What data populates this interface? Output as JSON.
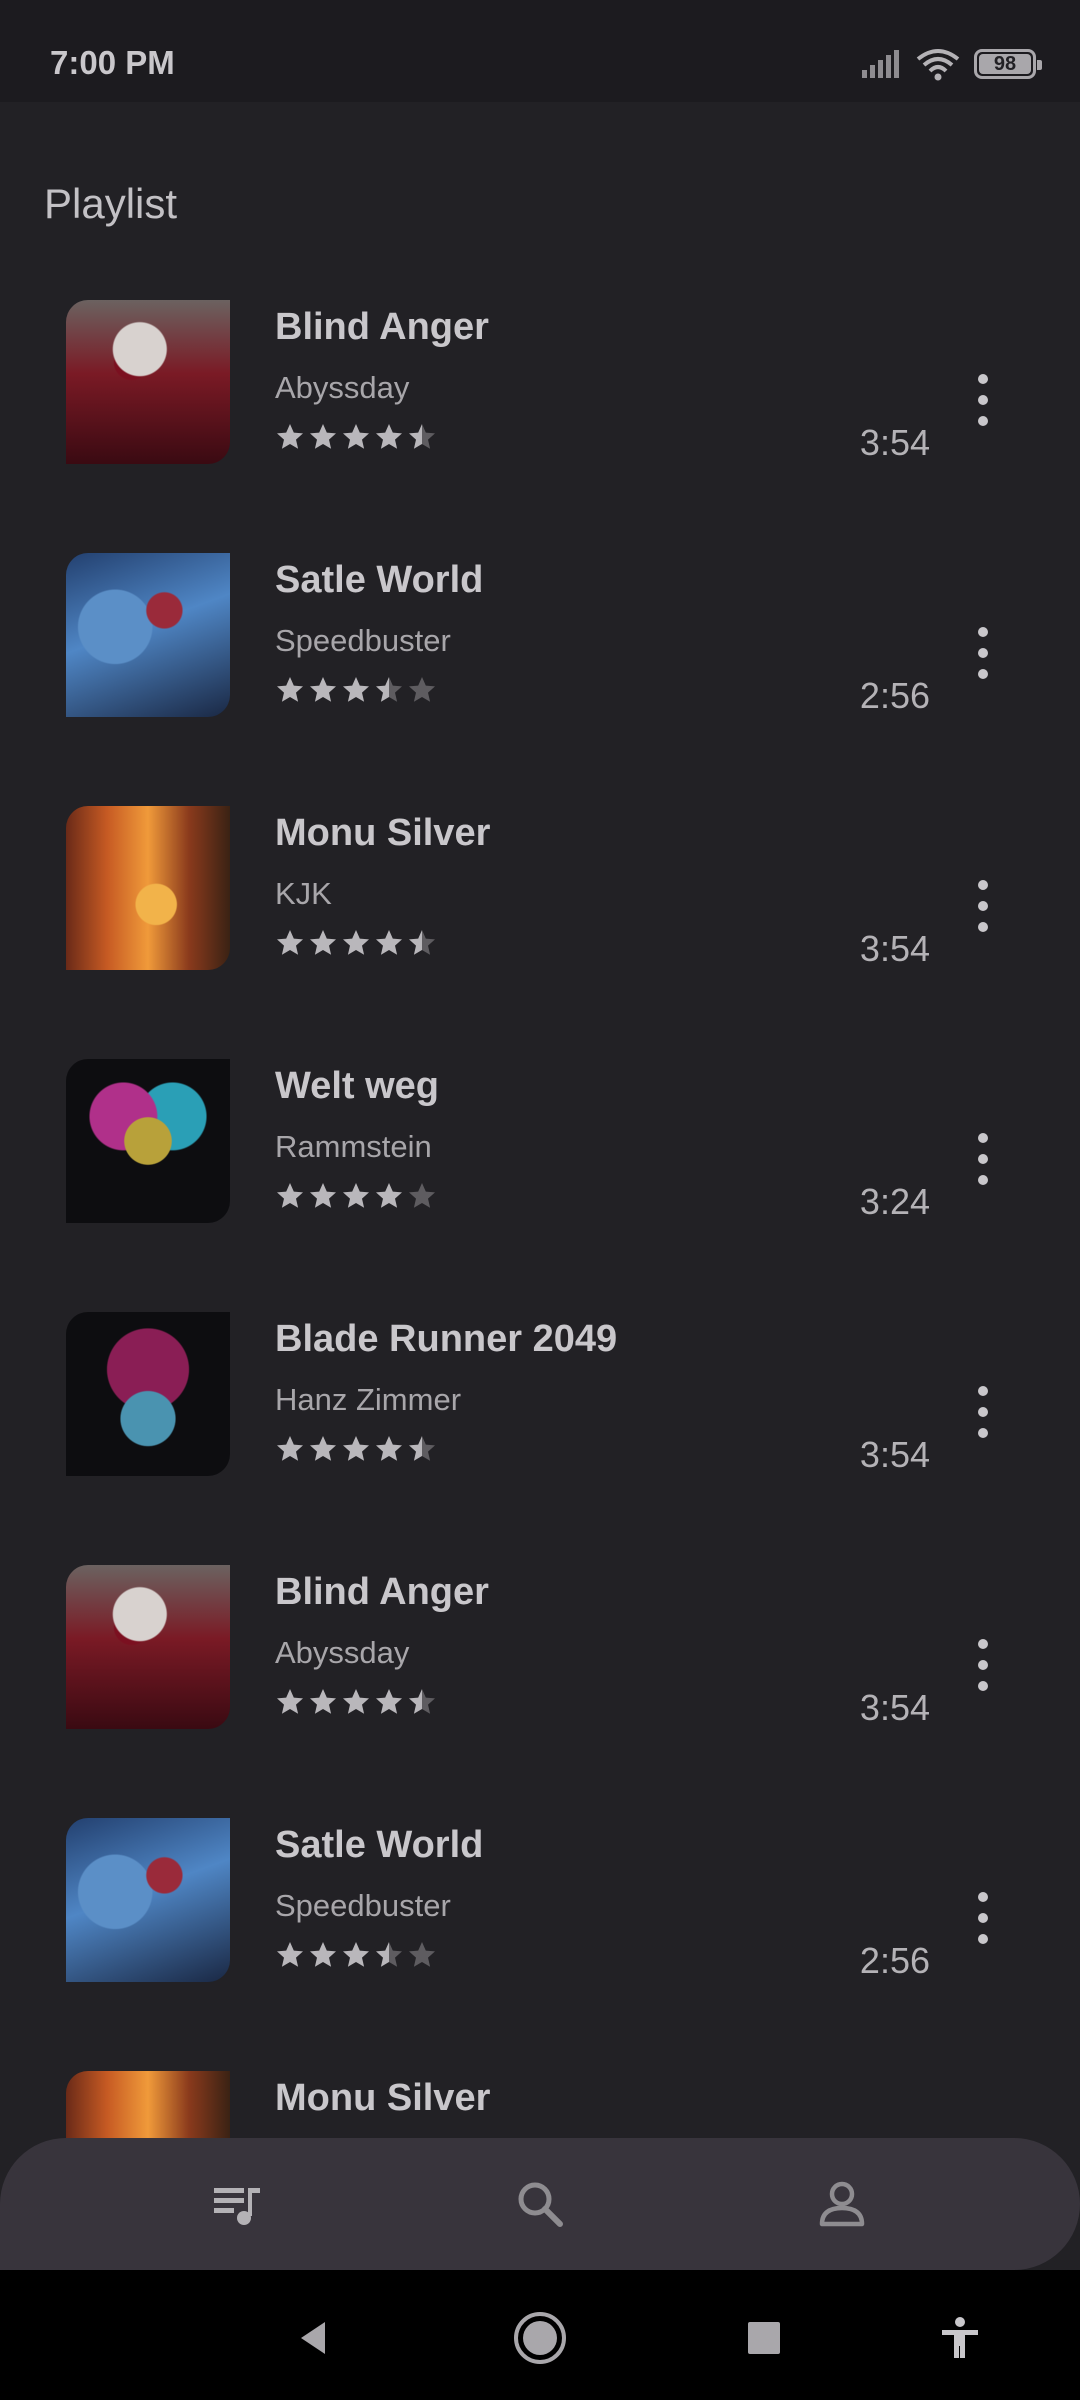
{
  "status_bar": {
    "time": "7:00 PM",
    "battery": "98"
  },
  "page": {
    "title": "Playlist"
  },
  "tracks": [
    {
      "title": "Blind Anger",
      "artist": "Abyssday",
      "rating": 4.5,
      "duration": "3:54",
      "art": "a1"
    },
    {
      "title": "Satle World",
      "artist": "Speedbuster",
      "rating": 3.5,
      "duration": "2:56",
      "art": "a2"
    },
    {
      "title": "Monu Silver",
      "artist": "KJK",
      "rating": 4.5,
      "duration": "3:54",
      "art": "a3"
    },
    {
      "title": "Welt weg",
      "artist": "Rammstein",
      "rating": 4,
      "duration": "3:24",
      "art": "a4"
    },
    {
      "title": "Blade Runner 2049",
      "artist": "Hanz Zimmer",
      "rating": 4.5,
      "duration": "3:54",
      "art": "a5"
    },
    {
      "title": "Blind Anger",
      "artist": "Abyssday",
      "rating": 4.5,
      "duration": "3:54",
      "art": "a1"
    },
    {
      "title": "Satle World",
      "artist": "Speedbuster",
      "rating": 3.5,
      "duration": "2:56",
      "art": "a2"
    },
    {
      "title": "Monu Silver",
      "artist": "",
      "rating": 0,
      "duration": "",
      "art": "a3"
    }
  ],
  "bottom_nav": [
    {
      "icon": "queue-music-icon",
      "active": true
    },
    {
      "icon": "search-icon",
      "active": false
    },
    {
      "icon": "person-icon",
      "active": false
    }
  ],
  "system_nav": [
    "back-icon",
    "home-icon",
    "recents-icon",
    "accessibility-icon"
  ],
  "colors": {
    "background": "#222125",
    "text": "#c9c7cb",
    "nav": "#38343c"
  }
}
